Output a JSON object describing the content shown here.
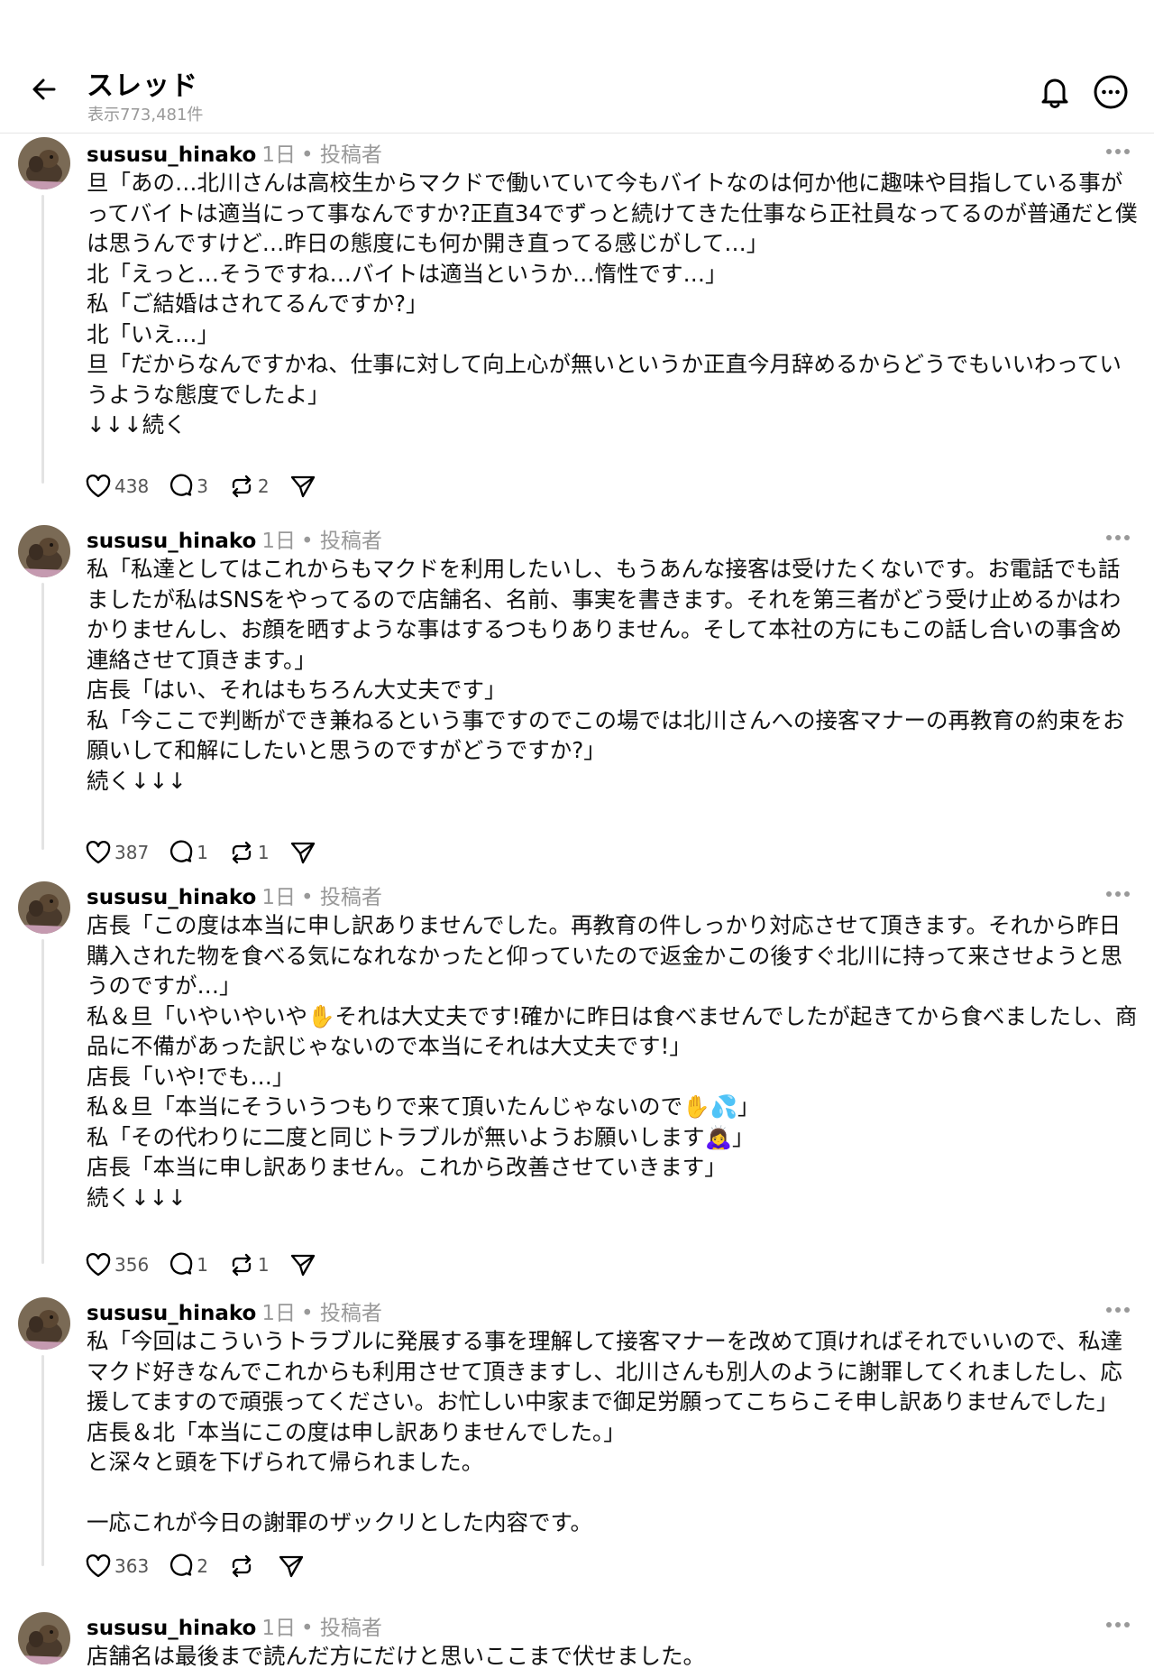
{
  "header": {
    "title": "スレッド",
    "views": "表示773,481件"
  },
  "posts": [
    {
      "username": "sususu_hinako",
      "time": "1日",
      "role": "• 投稿者",
      "text": "旦「あの…北川さんは高校生からマクドで働いていて今もバイトなのは何か他に趣味や目指している事がってバイトは適当にって事なんですか?正直34でずっと続けてきた仕事なら正社員なってるのが普通だと僕は思うんですけど…昨日の態度にも何か開き直ってる感じがして…」\n北「えっと…そうですね…バイトは適当というか…惰性です…」\n私「ご結婚はされてるんですか?」\n北「いえ…」\n旦「だからなんですかね、仕事に対して向上心が無いというか正直今月辞めるからどうでもいいわっていうような態度でしたよ」\n↓↓↓続く",
      "likes": "438",
      "replies": "3",
      "reposts": "2"
    },
    {
      "username": "sususu_hinako",
      "time": "1日",
      "role": "• 投稿者",
      "text": "私「私達としてはこれからもマクドを利用したいし、もうあんな接客は受けたくないです。お電話でも話ましたが私はSNSをやってるので店舗名、名前、事実を書きます。それを第三者がどう受け止めるかはわかりませんし、お顔を晒すような事はするつもりありません。そして本社の方にもこの話し合いの事含め連絡させて頂きます。」\n店長「はい、それはもちろん大丈夫です」\n私「今ここで判断ができ兼ねるという事ですのでこの場では北川さんへの接客マナーの再教育の約束をお願いして和解にしたいと思うのですがどうですか?」\n続く↓↓↓",
      "likes": "387",
      "replies": "1",
      "reposts": "1"
    },
    {
      "username": "sususu_hinako",
      "time": "1日",
      "role": "• 投稿者",
      "text": "店長「この度は本当に申し訳ありませんでした。再教育の件しっかり対応させて頂きます。それから昨日購入された物を食べる気になれなかったと仰っていたので返金かこの後すぐ北川に持って来させようと思うのですが…」\n私＆旦「いやいやいや✋それは大丈夫です!確かに昨日は食べませんでしたが起きてから食べましたし、商品に不備があった訳じゃないので本当にそれは大丈夫です!」\n店長「いや!でも…」\n私＆旦「本当にそういうつもりで来て頂いたんじゃないので✋💦」\n私「その代わりに二度と同じトラブルが無いようお願いします🙇‍♀️」\n店長「本当に申し訳ありません。これから改善させていきます」\n続く↓↓↓",
      "likes": "356",
      "replies": "1",
      "reposts": "1"
    },
    {
      "username": "sususu_hinako",
      "time": "1日",
      "role": "• 投稿者",
      "text": "私「今回はこういうトラブルに発展する事を理解して接客マナーを改めて頂ければそれでいいので、私達マクド好きなんでこれからも利用させて頂きますし、北川さんも別人のように謝罪してくれましたし、応援してますので頑張ってください。お忙しい中家まで御足労願ってこちらこそ申し訳ありませんでした」\n店長＆北「本当にこの度は申し訳ありませんでした。」\nと深々と頭を下げられて帰られました。\n\n一応これが今日の謝罪のザックリとした内容です。",
      "likes": "363",
      "replies": "2",
      "reposts": ""
    },
    {
      "username": "sususu_hinako",
      "time": "1日",
      "role": "• 投稿者",
      "text": "店舗名は最後まで読んだ方にだけと思いここまで伏せました。",
      "likes": "",
      "replies": "",
      "reposts": ""
    }
  ],
  "icons": {
    "back": "arrow-left-icon",
    "bell": "bell-icon",
    "more": "more-circle-icon",
    "like": "heart-icon",
    "reply": "comment-icon",
    "repost": "repost-icon",
    "share": "send-icon"
  }
}
